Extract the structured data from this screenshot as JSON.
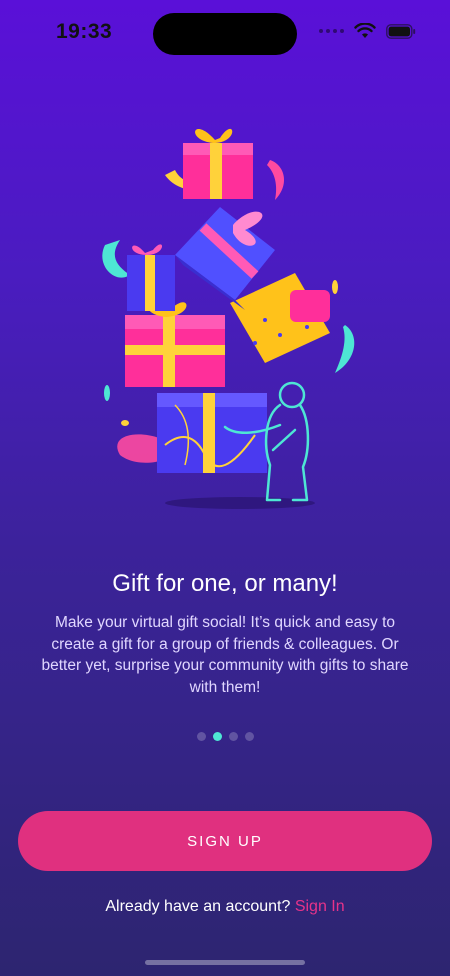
{
  "status_bar": {
    "time": "19:33",
    "icons": [
      "cellular-dots-icon",
      "wifi-icon",
      "battery-icon"
    ]
  },
  "illustration": {
    "subject": "gift-stack-illustration"
  },
  "onboarding": {
    "title": "Gift for one, or many!",
    "description": "Make your virtual gift social! It’s quick and easy to create a gift for a group of friends & colleagues. Or better yet, surprise your community with gifts to share with them!",
    "page_count": 4,
    "active_page": 2
  },
  "actions": {
    "signup_label": "SIGN UP",
    "account_prompt": "Already have an account?",
    "signin_label": "Sign In"
  },
  "colors": {
    "accent_pink": "#e0307f",
    "pager_active": "#4ee6d4",
    "bg_top": "#5a10d8",
    "bg_bottom": "#2d2570"
  }
}
